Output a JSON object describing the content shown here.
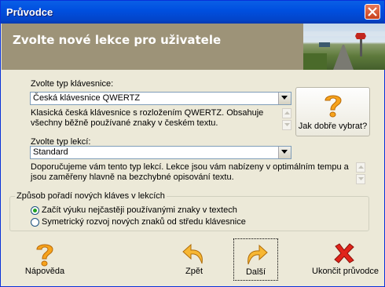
{
  "window": {
    "title": "Průvodce"
  },
  "banner": {
    "title": "Zvolte nové lekce pro uživatele"
  },
  "keyboard": {
    "label": "Zvolte typ klávesnice:",
    "selected": "Česká klávesnice QWERTZ",
    "description": "Klasická česká klávesnice s rozložením QWERTZ. Obsahuje všechny běžně používané znaky v českém textu."
  },
  "lesson": {
    "label": "Zvolte typ lekcí:",
    "selected": "Standard",
    "description": "Doporučujeme vám tento typ lekcí. Lekce jsou vám nabízeny v optimálním tempu a jsou zaměřeny hlavně na bezchybné opisování textu."
  },
  "help_choose": {
    "label": "Jak dobře vybrat?",
    "icon": "question-mark-icon"
  },
  "order_group": {
    "title": "Způsob pořadí nových kláves v lekcích",
    "options": [
      {
        "label": "Začít výuku nejčastěji používanými znaky v textech",
        "selected": true
      },
      {
        "label": "Symetrický rozvoj nových znaků od středu klávesnice",
        "selected": false
      }
    ]
  },
  "buttons": {
    "help": "Nápověda",
    "back": "Zpět",
    "next": "Další",
    "quit": "Ukončit průvodce"
  },
  "colors": {
    "titlebar": "#0a5fe6",
    "banner": "#9d9378",
    "window": "#ECE9D8",
    "accent_orange": "#f7a31c",
    "close_red": "#e0241b"
  }
}
